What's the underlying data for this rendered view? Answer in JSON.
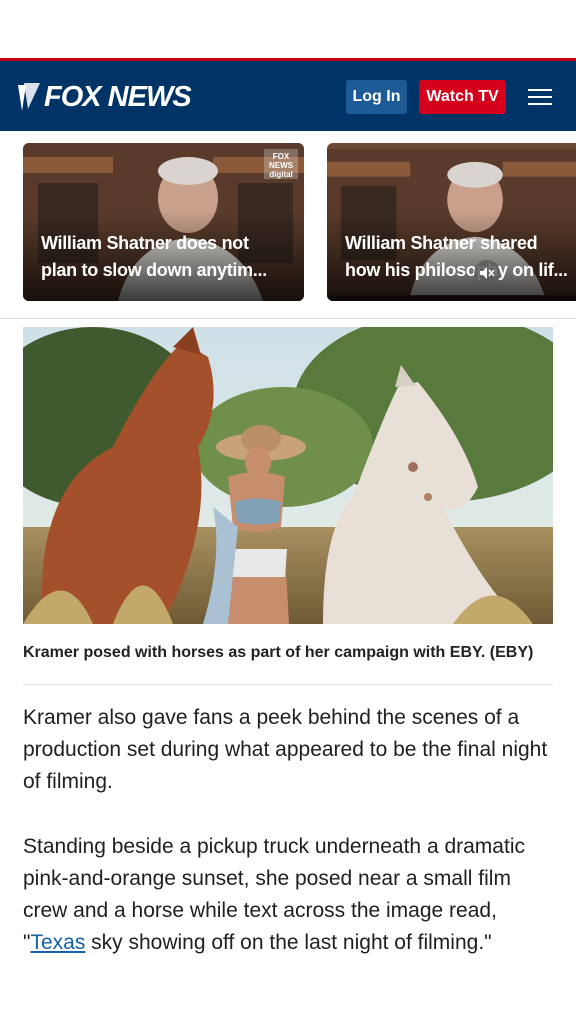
{
  "header": {
    "logo_text": "FOX NEWS",
    "login_label": "Log In",
    "watch_label": "Watch TV",
    "colors": {
      "bar": "#003366",
      "accent_red": "#c20017",
      "watch_button": "#d5001c",
      "login_button": "#1d5b96"
    }
  },
  "videos": [
    {
      "line1": "William Shatner does not",
      "line2": "plan to slow down anytim...",
      "badge": "FOX NEWS digital"
    },
    {
      "line1": "William Shatner shared",
      "line2": "how his philosophy on lif..."
    }
  ],
  "article": {
    "caption": "Kramer posed with horses as part of her campaign with EBY. (EBY)",
    "paragraph1": "Kramer also gave fans a peek behind the scenes of a production set during what appeared to be the final night of filming.",
    "paragraph2_before": "Standing beside a pickup truck underneath a dramatic pink-and-orange sunset, she posed near a small film crew and a horse while text across the image read, \"",
    "paragraph2_link": "Texas",
    "paragraph2_after": " sky showing off on the last night of filming.\""
  },
  "icons": {
    "logo": "fox-logo-icon",
    "menu": "hamburger-menu-icon",
    "mute": "mute-icon"
  }
}
